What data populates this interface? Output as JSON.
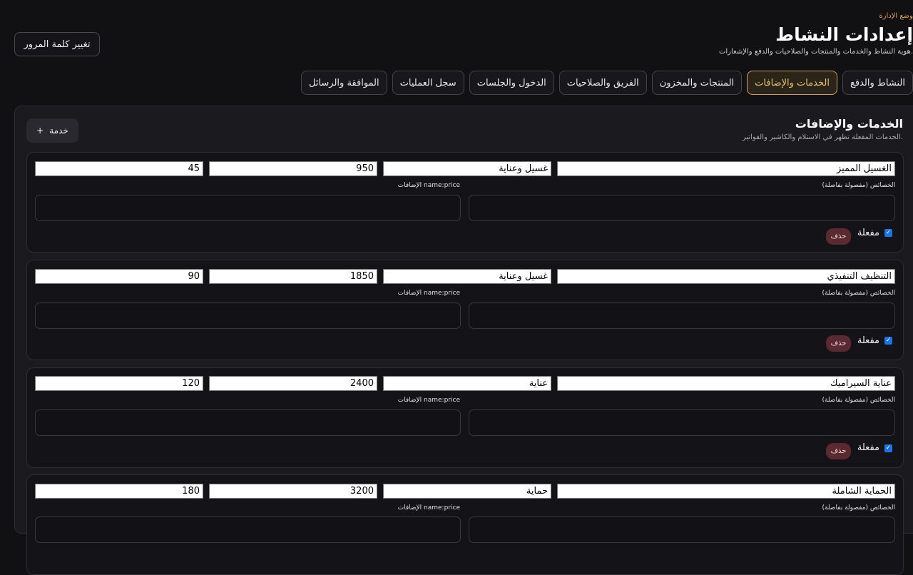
{
  "header": {
    "eyebrow": "وضع الإدارة",
    "title": "إعدادات النشاط",
    "subtitle": "هوية النشاط والخدمات والمنتجات والصلاحيات والدفع والإشعارات."
  },
  "change_password_label": "تغيير كلمة المرور",
  "tabs": [
    {
      "label": "النشاط والدفع",
      "active": false
    },
    {
      "label": "الخدمات والإضافات",
      "active": true
    },
    {
      "label": "المنتجات والمخزون",
      "active": false
    },
    {
      "label": "الفريق والصلاحيات",
      "active": false
    },
    {
      "label": "الدخول والجلسات",
      "active": false
    },
    {
      "label": "سجل العمليات",
      "active": false
    },
    {
      "label": "الموافقة والرسائل",
      "active": false
    }
  ],
  "section": {
    "title": "الخدمات والإضافات",
    "subtitle": "الخدمات المفعلة تظهر في الاستلام والكاشير والفواتير.",
    "add_button_label": "خدمة",
    "add_icon": "+"
  },
  "card_labels": {
    "features": "الخصائص (مفصولة بفاصلة)",
    "addons": "الإضافات name:price",
    "active": "مفعلة",
    "delete": "حذف"
  },
  "services": [
    {
      "name": "الغسيل المميز",
      "category": "غسيل وعناية",
      "price": "950",
      "duration": "45",
      "active": true
    },
    {
      "name": "التنظيف التنفيذي",
      "category": "غسيل وعناية",
      "price": "1850",
      "duration": "90",
      "active": true
    },
    {
      "name": "عناية السيراميك",
      "category": "عناية",
      "price": "2400",
      "duration": "120",
      "active": true
    },
    {
      "name": "الحماية الشاملة",
      "category": "حماية",
      "price": "3200",
      "duration": "180",
      "active": true
    }
  ],
  "colors": {
    "background": "#111013",
    "accent": "#c8a35f",
    "checkbox": "#1a73e8",
    "delete": "#5a2a30"
  }
}
